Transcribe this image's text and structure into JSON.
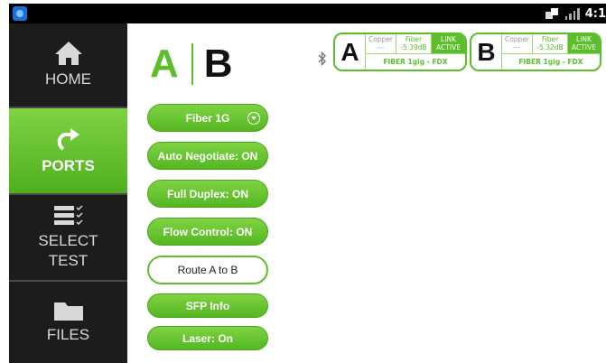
{
  "status_bar": {
    "time": "4:1"
  },
  "sidebar": {
    "items": [
      {
        "label": "HOME",
        "icon": "home-icon",
        "active": false
      },
      {
        "label": "PORTS",
        "icon": "ports-icon",
        "active": true
      },
      {
        "label_line1": "SELECT",
        "label_line2": "TEST",
        "icon": "select-test-icon",
        "active": false
      },
      {
        "label": "FILES",
        "icon": "folder-icon",
        "active": false
      }
    ]
  },
  "port_header": {
    "a": "A",
    "b": "B"
  },
  "settings": {
    "media": "Fiber 1G",
    "auto_negotiate": "Auto Negotiate: ON",
    "full_duplex": "Full Duplex: ON",
    "flow_control": "Flow Control: ON",
    "route": "Route A to B",
    "sfp_info": "SFP Info",
    "laser": "Laser: On"
  },
  "port_status": [
    {
      "port": "A",
      "copper_label": "Copper",
      "copper_value": "---",
      "fiber_label": "Fiber",
      "fiber_value": "-5.39dB",
      "link_line1": "LINK",
      "link_line2": "ACTIVE",
      "mode": "FIBER 1gig  - FDX"
    },
    {
      "port": "B",
      "copper_label": "Copper",
      "copper_value": "---",
      "fiber_label": "Fiber",
      "fiber_value": "-5.32dB",
      "link_line1": "LINK",
      "link_line2": "ACTIVE",
      "mode": "FIBER 1gig  - FDX"
    }
  ],
  "colors": {
    "accent": "#5cbf2a",
    "sidebar_bg": "#1c1c1c",
    "status_bar_bg": "#000000"
  }
}
